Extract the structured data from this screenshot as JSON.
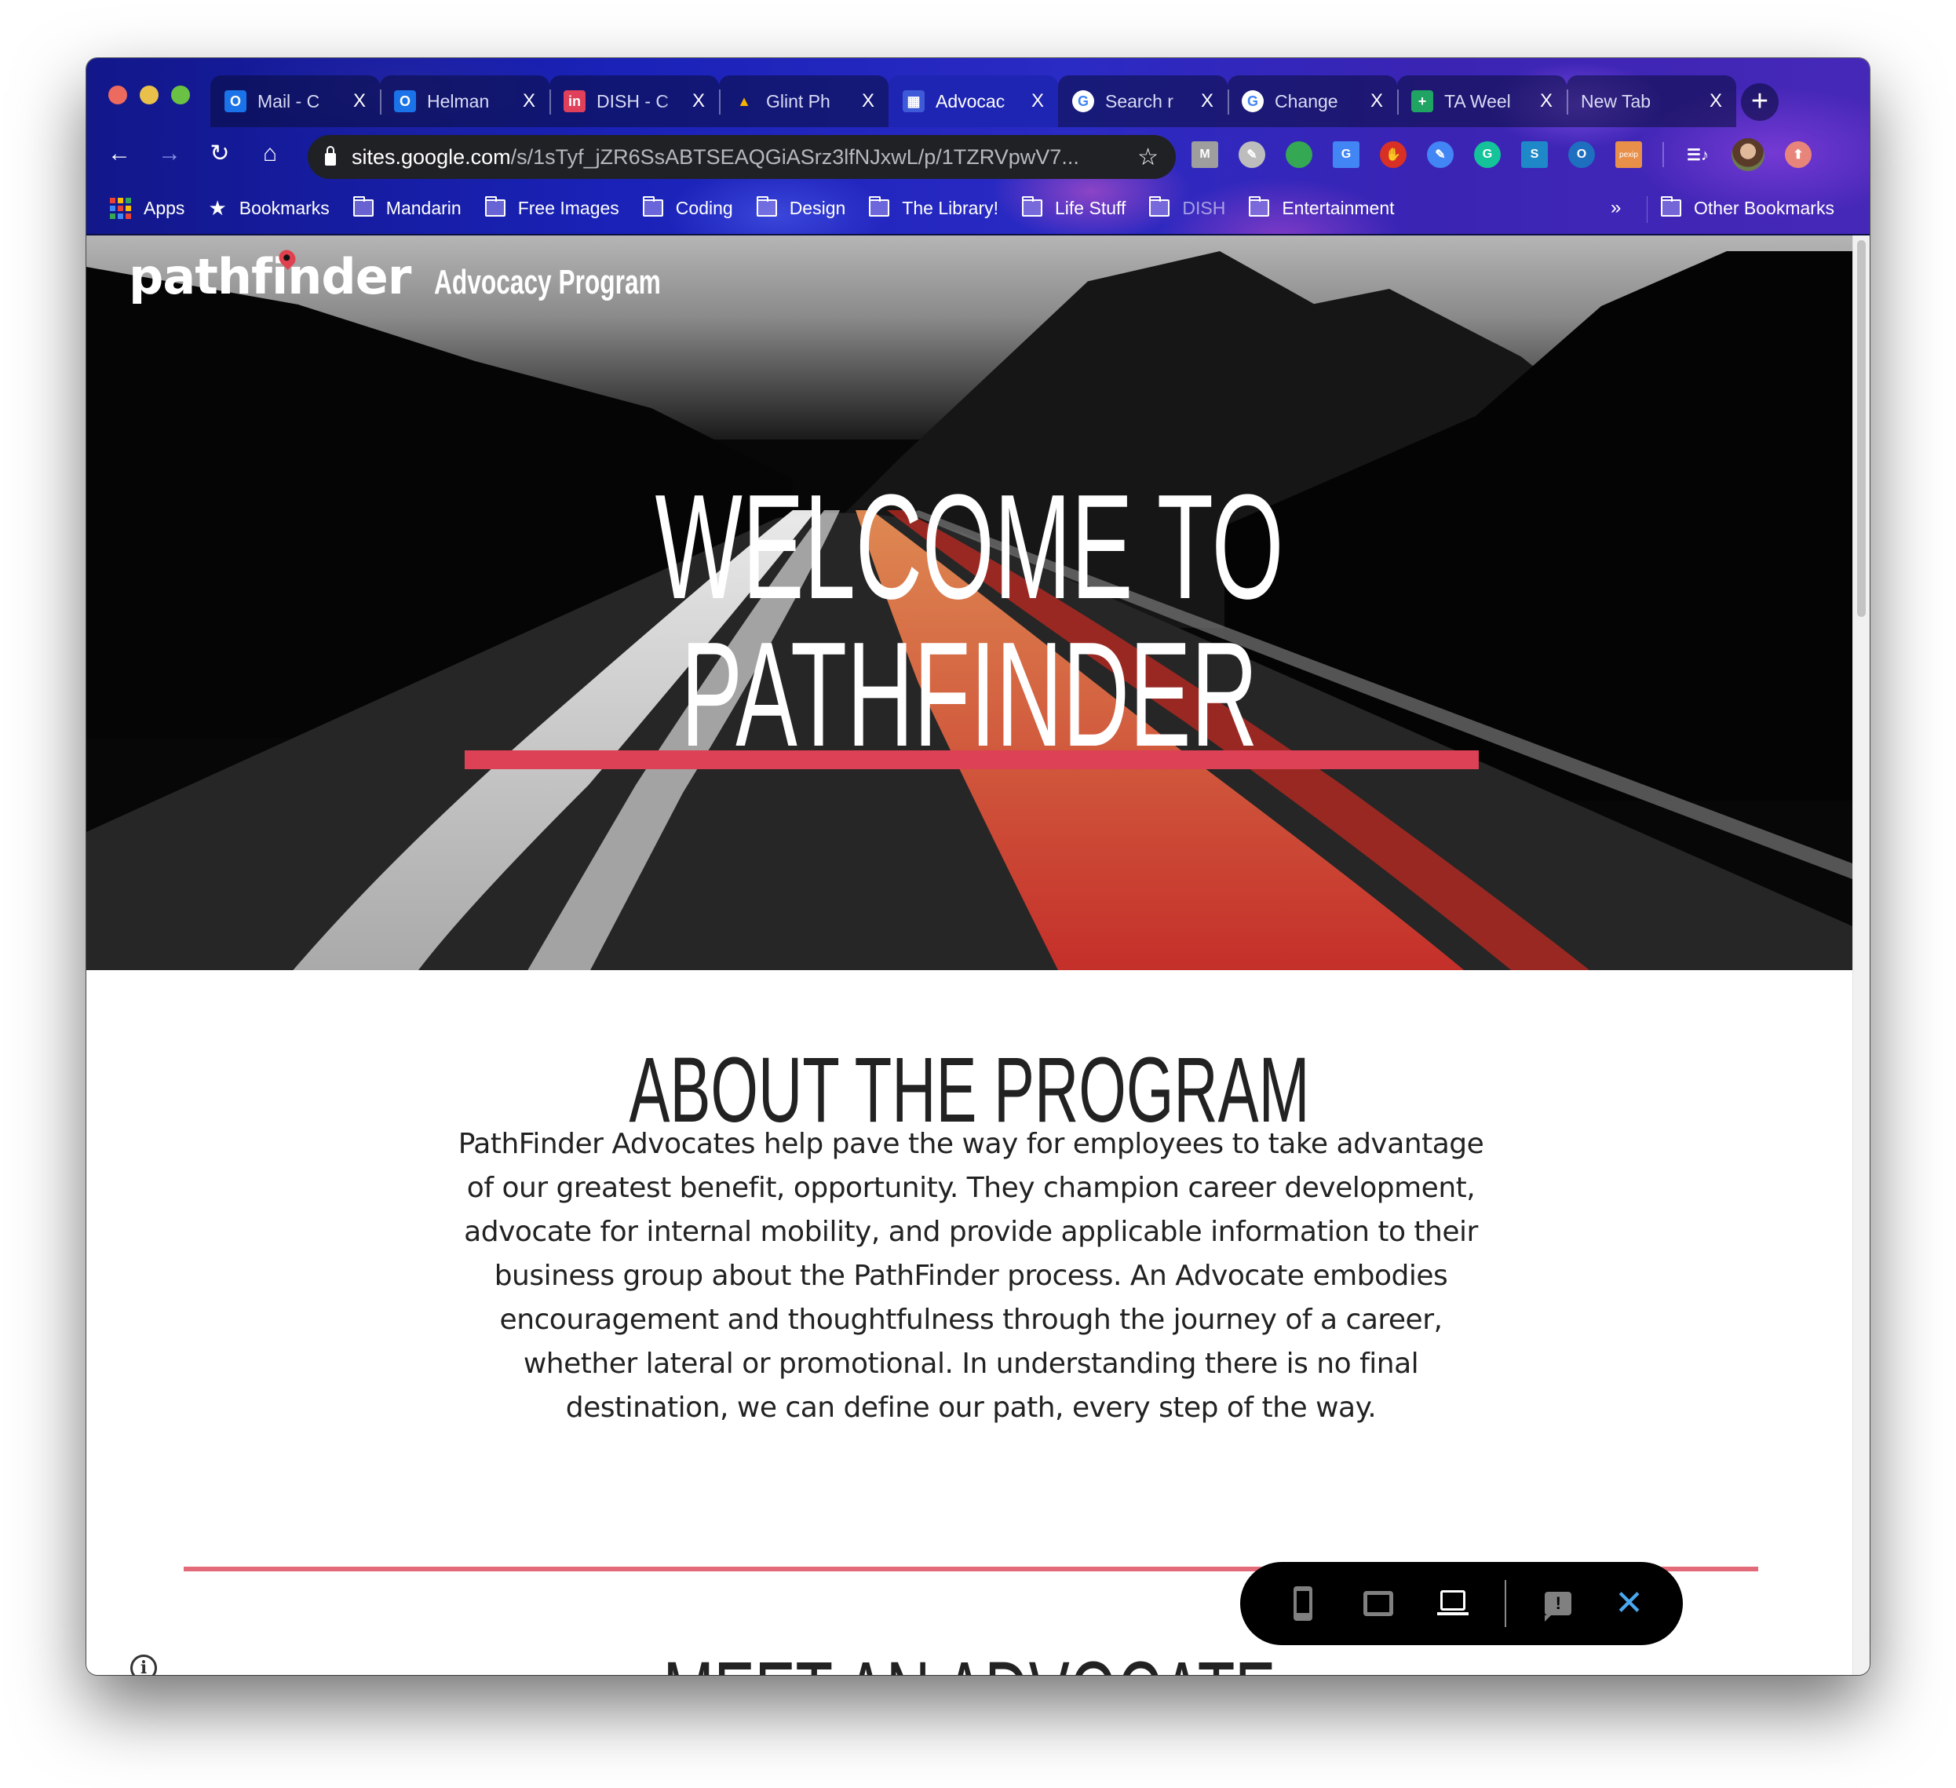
{
  "browser": {
    "tabs": [
      {
        "title": "Mail - C",
        "favicon": "outlook-icon",
        "color": "#1a73e8",
        "glyph": "O",
        "active": false
      },
      {
        "title": "Helman",
        "favicon": "outlook-icon",
        "color": "#1a73e8",
        "glyph": "O",
        "active": false
      },
      {
        "title": "DISH - C",
        "favicon": "invision-icon",
        "color": "#e0405a",
        "glyph": "in",
        "active": false
      },
      {
        "title": "Glint Ph",
        "favicon": "google-drive-icon",
        "color": "#f4b400",
        "glyph": "▲",
        "active": false
      },
      {
        "title": "Advocac",
        "favicon": "google-sites-icon",
        "color": "#3f5ad8",
        "glyph": "▦",
        "active": true
      },
      {
        "title": "Search r",
        "favicon": "google-icon",
        "color": "#ffffff",
        "glyph": "G",
        "active": false
      },
      {
        "title": "Change",
        "favicon": "google-icon",
        "color": "#ffffff",
        "glyph": "G",
        "active": false
      },
      {
        "title": "TA Weel",
        "favicon": "google-sheets-icon",
        "color": "#1fa463",
        "glyph": "+",
        "active": false
      },
      {
        "title": "New Tab",
        "favicon": "",
        "color": "",
        "glyph": "",
        "active": false
      }
    ],
    "tab_close_glyph": "X",
    "new_tab_glyph": "+",
    "nav": {
      "back": "←",
      "forward": "→",
      "reload": "↻",
      "home": "⌂"
    },
    "url_host": "sites.google.com",
    "url_path": "/s/1sTyf_jZR6SsABTSEAQGiASrz3lfNJxwL/p/1TZRVpwV7...",
    "bookmark_star": "☆",
    "extensions": [
      {
        "name": "gmail-checker-extension-icon",
        "glyph": "M",
        "color": "#9e9e9e"
      },
      {
        "name": "eyedropper-extension-icon",
        "glyph": "✎",
        "color": "#bdbdbd"
      },
      {
        "name": "hangouts-extension-icon",
        "glyph": "",
        "color": "#34a853"
      },
      {
        "name": "google-translate-extension-icon",
        "glyph": "G",
        "color": "#4285f4"
      },
      {
        "name": "adblock-extension-icon",
        "glyph": "✋",
        "color": "#d93025"
      },
      {
        "name": "google-keep-extension-icon",
        "glyph": "✎",
        "color": "#4285f4"
      },
      {
        "name": "grammarly-extension-icon",
        "glyph": "G",
        "color": "#15c39a"
      },
      {
        "name": "s-extension-icon",
        "glyph": "S",
        "color": "#1e88c8"
      },
      {
        "name": "o-extension-icon",
        "glyph": "O",
        "color": "#1e6fc0"
      },
      {
        "name": "pexip-extension-icon",
        "glyph": "pexip",
        "color": "#e8904a"
      }
    ],
    "media_glyph": "☰♪",
    "update_glyph": "⬆",
    "bookmarks": [
      {
        "label": "Apps",
        "type": "apps"
      },
      {
        "label": "Bookmarks",
        "type": "star"
      },
      {
        "label": "Mandarin",
        "type": "folder"
      },
      {
        "label": "Free Images",
        "type": "folder"
      },
      {
        "label": "Coding",
        "type": "folder"
      },
      {
        "label": "Design",
        "type": "folder"
      },
      {
        "label": "The Library!",
        "type": "folder"
      },
      {
        "label": "Life Stuff",
        "type": "folder"
      },
      {
        "label": "DISH",
        "type": "folder"
      },
      {
        "label": "Entertainment",
        "type": "folder"
      }
    ],
    "bookmarks_overflow": "»",
    "other_bookmarks": "Other Bookmarks"
  },
  "site": {
    "logo_text": "pathfinder",
    "logo_subtitle": "Advocacy Program",
    "hero": {
      "title_line1": "WELCOME TO",
      "title_line2": "PATHFINDER"
    },
    "about": {
      "title": "ABOUT THE PROGRAM",
      "body": "PathFinder Advocates help pave the way for employees to take advantage of our greatest benefit, opportunity. They champion career development, advocate for internal mobility, and provide applicable information to their business group about the PathFinder process.  An Advocate embodies encouragement and thoughtfulness through the journey of a career, whether lateral or promotional. In understanding there is no final destination, we can define our path, every step of the way."
    },
    "meet": {
      "title": "MEET AN ADVOCATE"
    },
    "info_glyph": "i",
    "preview": {
      "close_glyph": "✕",
      "feedback_glyph": "!"
    },
    "colors": {
      "accent": "#dc4155",
      "divider": "#e36a79",
      "heading": "#222222",
      "preview_close": "#4aa8ef"
    }
  }
}
